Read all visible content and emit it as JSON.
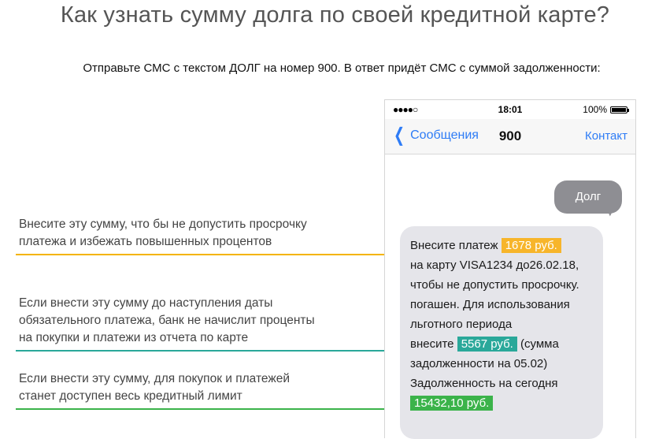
{
  "page": {
    "title": "Как узнать сумму долга по своей кредитной карте?",
    "subtitle": "Отправьте СМС с текстом ДОЛГ на номер 900. В ответ придёт СМС с суммой задолженности:"
  },
  "phone": {
    "status": {
      "signal": "●●●●○",
      "time": "18:01",
      "battery": "100%"
    },
    "nav": {
      "back_label": "Сообщения",
      "title": "900",
      "contact_label": "Контакт"
    },
    "outgoing": {
      "text": "Долг"
    },
    "incoming": {
      "line1_pre": "Внесите платеж ",
      "amount1": "1678 руб.",
      "line2": "на карту VISA1234 до26.02.18,",
      "line3": "чтобы не допустить просрочку.",
      "line4": "погашен. Для использования",
      "line5": "льготного периода",
      "line6_pre": "внесите ",
      "amount2": "5567 руб.",
      "line6_post": " (сумма",
      "line7": "задолженности на 05.02)",
      "line8": "Задолженность на сегодня",
      "amount3": "15432,10 руб."
    }
  },
  "callouts": {
    "c1_line1": "Внесите эту сумму, что бы не допустить просрочку",
    "c1_line2": "платежа и избежать повышенных процентов",
    "c2_line1": "Если внести эту сумму до наступления даты",
    "c2_line2": "обязательного платежа, банк не начислит проценты",
    "c2_line3": "на покупки и платежи из отчета по карте",
    "c3_line1": "Если внести эту сумму, для покупок и платежей",
    "c3_line2": "станет доступен весь кредитный лимит"
  },
  "colors": {
    "orange": "#f7b52b",
    "teal": "#2aa89a",
    "green": "#3bb34a",
    "ios_blue": "#2e7cf6"
  }
}
